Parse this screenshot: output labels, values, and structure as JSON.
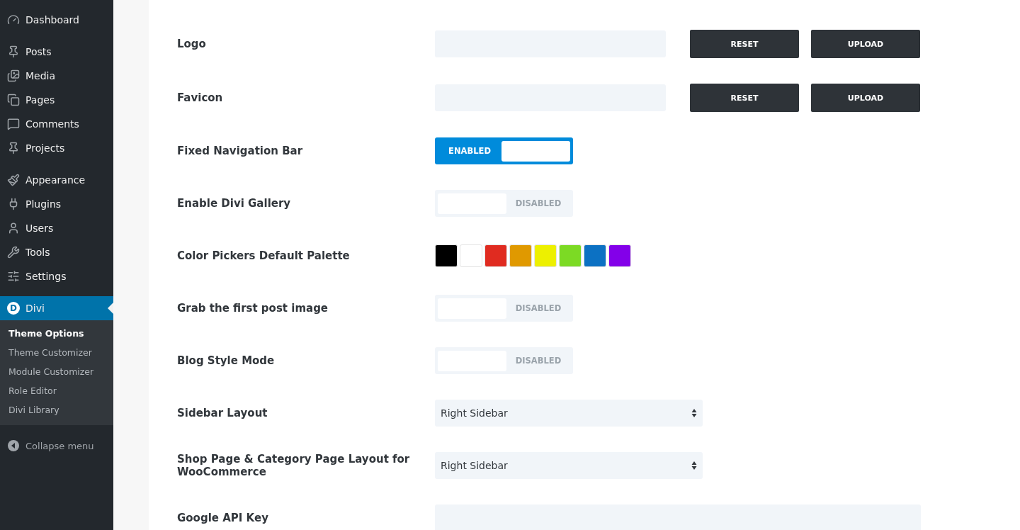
{
  "sidebar": {
    "groups": [
      [
        {
          "label": "Dashboard",
          "selected": false
        }
      ],
      [
        {
          "label": "Posts",
          "selected": false
        },
        {
          "label": "Media",
          "selected": false
        },
        {
          "label": "Pages",
          "selected": false
        },
        {
          "label": "Comments",
          "selected": false
        },
        {
          "label": "Projects",
          "selected": false
        }
      ],
      [
        {
          "label": "Appearance",
          "selected": false
        },
        {
          "label": "Plugins",
          "selected": false
        },
        {
          "label": "Users",
          "selected": false
        },
        {
          "label": "Tools",
          "selected": false
        },
        {
          "label": "Settings",
          "selected": false
        }
      ],
      [
        {
          "label": "Divi",
          "selected": true,
          "logo": "D"
        }
      ]
    ],
    "submenu": [
      {
        "label": "Theme Options",
        "selected": true
      },
      {
        "label": "Theme Customizer",
        "selected": false
      },
      {
        "label": "Module Customizer",
        "selected": false
      },
      {
        "label": "Role Editor",
        "selected": false
      },
      {
        "label": "Divi Library",
        "selected": false
      }
    ],
    "collapse": "Collapse menu"
  },
  "options": [
    {
      "kind": "upload",
      "label": "Logo",
      "buttons": [
        "RESET",
        "UPLOAD"
      ]
    },
    {
      "kind": "upload",
      "label": "Favicon",
      "buttons": [
        "RESET",
        "UPLOAD"
      ]
    },
    {
      "kind": "toggle",
      "label": "Fixed Navigation Bar",
      "on": true,
      "state": "ENABLED"
    },
    {
      "kind": "toggle",
      "label": "Enable Divi Gallery",
      "on": false,
      "state": "DISABLED"
    },
    {
      "kind": "palette",
      "label": "Color Pickers Default Palette",
      "colors": [
        {
          "color": "#000000"
        },
        {
          "color": "#ffffff"
        },
        {
          "color": "#e02b20"
        },
        {
          "color": "#e09900"
        },
        {
          "color": "#edf000"
        },
        {
          "color": "#7cda24"
        },
        {
          "color": "#0c71c3"
        },
        {
          "color": "#8300e9"
        }
      ]
    },
    {
      "kind": "toggle",
      "label": "Grab the first post image",
      "on": false,
      "state": "DISABLED"
    },
    {
      "kind": "toggle",
      "label": "Blog Style Mode",
      "on": false,
      "state": "DISABLED"
    },
    {
      "kind": "select",
      "label": "Sidebar Layout",
      "value": "Right Sidebar"
    },
    {
      "kind": "select",
      "label": "Shop Page & Category Page Layout for WooCommerce",
      "value": "Right Sidebar"
    },
    {
      "kind": "text",
      "label": "Google API Key"
    }
  ]
}
